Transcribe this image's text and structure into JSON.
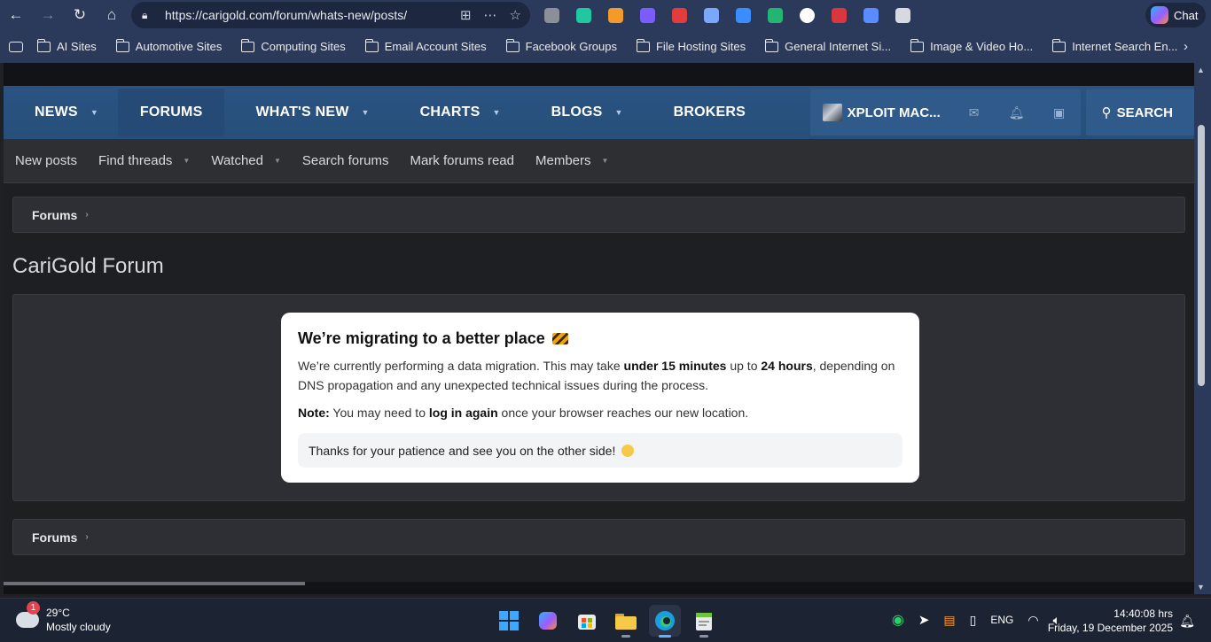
{
  "browser": {
    "url": "https://carigold.com/forum/whats-new/posts/",
    "chat_label": "Chat",
    "extension_colors": [
      "#8a8f9a",
      "#1fc8a0",
      "#f49a2a",
      "#7b5cff",
      "#e23c3c",
      "#7ba7ff",
      "#3b8cff",
      "#22b573",
      "#ffffff",
      "#d9363e",
      "#5b8cff",
      "#d6d9df"
    ],
    "bookmarks": [
      "AI Sites",
      "Automotive Sites",
      "Computing Sites",
      "Email Account Sites",
      "Facebook Groups",
      "File Hosting Sites",
      "General Internet Si...",
      "Image & Video Ho...",
      "Internet Search En..."
    ]
  },
  "site": {
    "nav": [
      {
        "label": "NEWS",
        "has_menu": true
      },
      {
        "label": "FORUMS",
        "has_menu": false,
        "active": true
      },
      {
        "label": "WHAT'S NEW",
        "has_menu": true
      },
      {
        "label": "CHARTS",
        "has_menu": true
      },
      {
        "label": "BLOGS",
        "has_menu": true
      },
      {
        "label": "BROKERS",
        "has_menu": false
      }
    ],
    "username": "XPLOIT MAC...",
    "search_label": "SEARCH",
    "subnav": [
      {
        "label": "New posts",
        "has_menu": false
      },
      {
        "label": "Find threads",
        "has_menu": true
      },
      {
        "label": "Watched",
        "has_menu": true
      },
      {
        "label": "Search forums",
        "has_menu": false
      },
      {
        "label": "Mark forums read",
        "has_menu": false
      },
      {
        "label": "Members",
        "has_menu": true
      }
    ],
    "breadcrumb": "Forums",
    "page_title": "CariGold Forum",
    "notice": {
      "heading": "We’re migrating to a better place",
      "p1_a": "We’re currently performing a data migration. This may take ",
      "p1_b": "under 15 minutes",
      "p1_c": " up to ",
      "p1_d": "24 hours",
      "p1_e": ", depending on DNS propagation and any unexpected technical issues during the process.",
      "p2_a": "Note:",
      "p2_b": " You may need to ",
      "p2_c": "log in again",
      "p2_d": " once your browser reaches our new location.",
      "thanks": "Thanks for your patience and see you on the other side!"
    }
  },
  "taskbar": {
    "weather_badge": "1",
    "temperature": "29°C",
    "condition": "Mostly cloudy",
    "language": "ENG",
    "time": "14:40:08 hrs",
    "date": "Friday, 19 December 2025"
  }
}
